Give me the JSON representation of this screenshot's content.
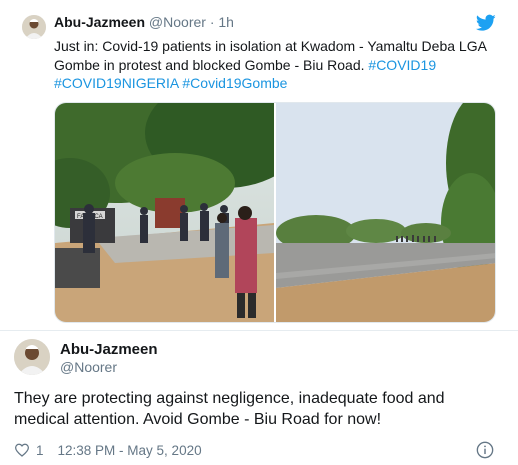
{
  "parent_tweet": {
    "name": "Abu-Jazmeen",
    "handle": "@Noorer",
    "dot": "·",
    "time": "1h",
    "text_line1": "Just in: Covid-19 patients in isolation at Kwadom - Yamaltu Deba LGA",
    "text_line2_plain": "Gombe in protest and blocked Gombe - Biu Road. ",
    "hashtag1": "#COVID19",
    "hashtag2": "#COVID19NIGERIA",
    "hashtag3": "#Covid19Gombe",
    "media_sign_text": "FABRICA"
  },
  "main_tweet": {
    "name": "Abu-Jazmeen",
    "handle": "@Noorer",
    "text": "They are protecting against negligence, inadequate food and medical attention. Avoid Gombe - Biu Road for now!",
    "like_count": "1",
    "timestamp": "12:38 PM - May 5, 2020"
  },
  "icons": {
    "twitter_bird": "twitter-bird-icon",
    "heart": "heart-icon",
    "info": "info-icon"
  },
  "colors": {
    "brand_blue": "#1da1f2",
    "link_blue": "#1b95e0",
    "secondary_text": "#657786",
    "primary_text": "#14171a",
    "divider": "#e6ecf0"
  }
}
